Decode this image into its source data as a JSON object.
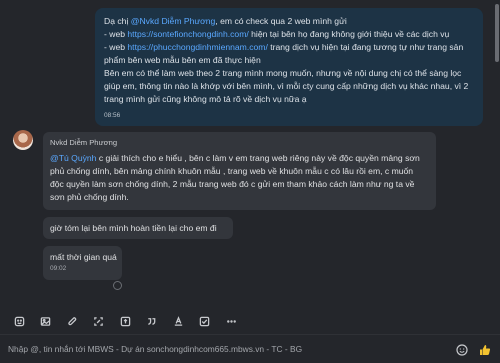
{
  "outgoing": {
    "line1_prefix": "Dạ chị ",
    "line1_mention": "@Nvkd Diễm Phương",
    "line1_suffix": ", em có check qua 2 web mình gửi",
    "line2_prefix": "- web ",
    "line2_link": "https://sontefionchongdinh.com/",
    "line2_suffix": " hiện tại bên họ đang không giới thiệu về các dịch vụ",
    "line3_prefix": "- web ",
    "line3_link": "https://phucchongdinhmiennam.com/",
    "line3_suffix": " trang dịch vụ hiện tại đang tương tự như trang sản",
    "line4": "phẩm bên web mẫu bên em đã thực hiện",
    "line5": "Bên em có thể làm web theo 2 trang mình mong muốn, nhưng về nội dung chị có thể sàng lọc",
    "line6": "giúp em, thông tin nào là khớp với bên mình, vì mỗi cty cung cấp những dịch vụ khác nhau, vì 2",
    "line7": "trang mình gửi cũng không mô tả rõ về dịch vụ nữa ạ",
    "time": "08:56"
  },
  "incoming": {
    "sender": "Nvkd Diễm Phương",
    "msg1_mention": "@Tú Quỳnh",
    "msg1_line1": " c giải thích cho e hiểu , bên c làm v em trang web riêng này về độc quyền mảng sơn",
    "msg1_line2": "phủ chống dính, bên mảng chính khuôn mẫu , trang web về khuôn mẫu c có lâu rồi em, c muốn",
    "msg1_line3": "độc quyền làm sơn chống dính, 2 mẫu trang web đó c gửi em tham khảo cách làm như ng ta về",
    "msg1_line4": "sơn phủ chống dính.",
    "msg2": "giờ tóm lại bên mình hoàn tiền lại cho em đi",
    "msg3": "mất thời gian quá",
    "msg3_time": "09:02"
  },
  "composer": {
    "placeholder": "Nhập @, tin nhắn tới MBWS - Dự án sonchongdinhcom665.mbws.vn - TC - BG"
  },
  "icons": {
    "toolbar": [
      "sticker-icon",
      "image-icon",
      "attachment-icon",
      "screenshot-icon",
      "card-icon",
      "quote-icon",
      "format-icon",
      "checklist-icon",
      "more-icon"
    ],
    "composer": [
      "emoji-icon",
      "like-icon"
    ]
  },
  "colors": {
    "background": "#24262b",
    "outgoing_bubble": "#1d3345",
    "incoming_bubble": "#33363c",
    "link": "#5aa8ff",
    "like": "#f2c230"
  }
}
